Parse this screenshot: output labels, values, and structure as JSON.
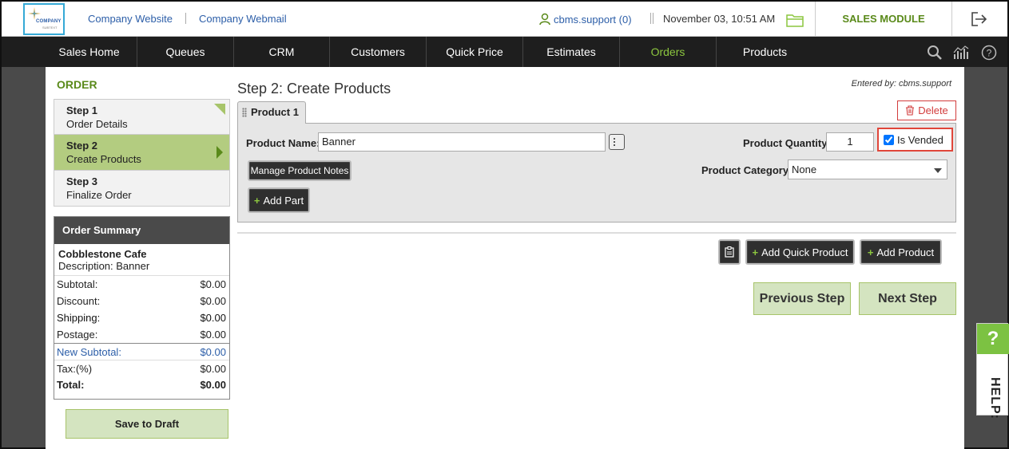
{
  "header": {
    "logo_text": "COMPANY",
    "logo_subtext": "SUBTEXT",
    "links": [
      "Company Website",
      "Company Webmail"
    ],
    "user": "cbms.support (0)",
    "datetime": "November 03, 10:51 AM",
    "module": "SALES MODULE"
  },
  "nav": {
    "items": [
      "Sales Home",
      "Queues",
      "CRM",
      "Customers",
      "Quick Price",
      "Estimates",
      "Orders",
      "Products"
    ],
    "active": "Orders"
  },
  "sidebar": {
    "title": "ORDER",
    "steps": [
      {
        "title": "Step 1",
        "subtitle": "Order Details"
      },
      {
        "title": "Step 2",
        "subtitle": "Create Products"
      },
      {
        "title": "Step 3",
        "subtitle": "Finalize Order"
      }
    ],
    "summary": {
      "heading": "Order Summary",
      "customer": "Cobblestone Cafe",
      "description_label": "Description:",
      "description": "Banner",
      "rows": [
        {
          "label": "Subtotal:",
          "value": "$0.00"
        },
        {
          "label": "Discount:",
          "value": "$0.00"
        },
        {
          "label": "Shipping:",
          "value": "$0.00"
        },
        {
          "label": "Postage:",
          "value": "$0.00"
        },
        {
          "label": "New Subtotal:",
          "value": "$0.00"
        },
        {
          "label": "Tax:(%)",
          "value": "$0.00"
        },
        {
          "label": "Total:",
          "value": "$0.00"
        }
      ]
    },
    "save_draft": "Save to Draft"
  },
  "main": {
    "step_title": "Step 2: Create Products",
    "entered_by": "Entered by: cbms.support",
    "tab_label": "Product 1",
    "delete_label": "Delete",
    "product_name_label": "Product Name:",
    "product_name_value": "Banner",
    "quantity_label": "Product Quantity:",
    "quantity_value": "1",
    "is_vended_label": "Is Vended",
    "is_vended_checked": true,
    "manage_notes_label": "Manage Product Notes",
    "category_label": "Product Category:",
    "category_value": "None",
    "add_part_label": "+ Add Part",
    "add_quick_product_label": "+ Add Quick Product",
    "add_product_label": "+ Add Product",
    "previous_step_label": "Previous Step",
    "next_step_label": "Next Step"
  },
  "help": {
    "icon": "?",
    "label": "HELP:"
  },
  "colors": {
    "accent_green": "#8cc63f",
    "brand_blue": "#2c5ea8",
    "nav_bg": "#1e1e1e",
    "highlight_red": "#e0463a"
  }
}
